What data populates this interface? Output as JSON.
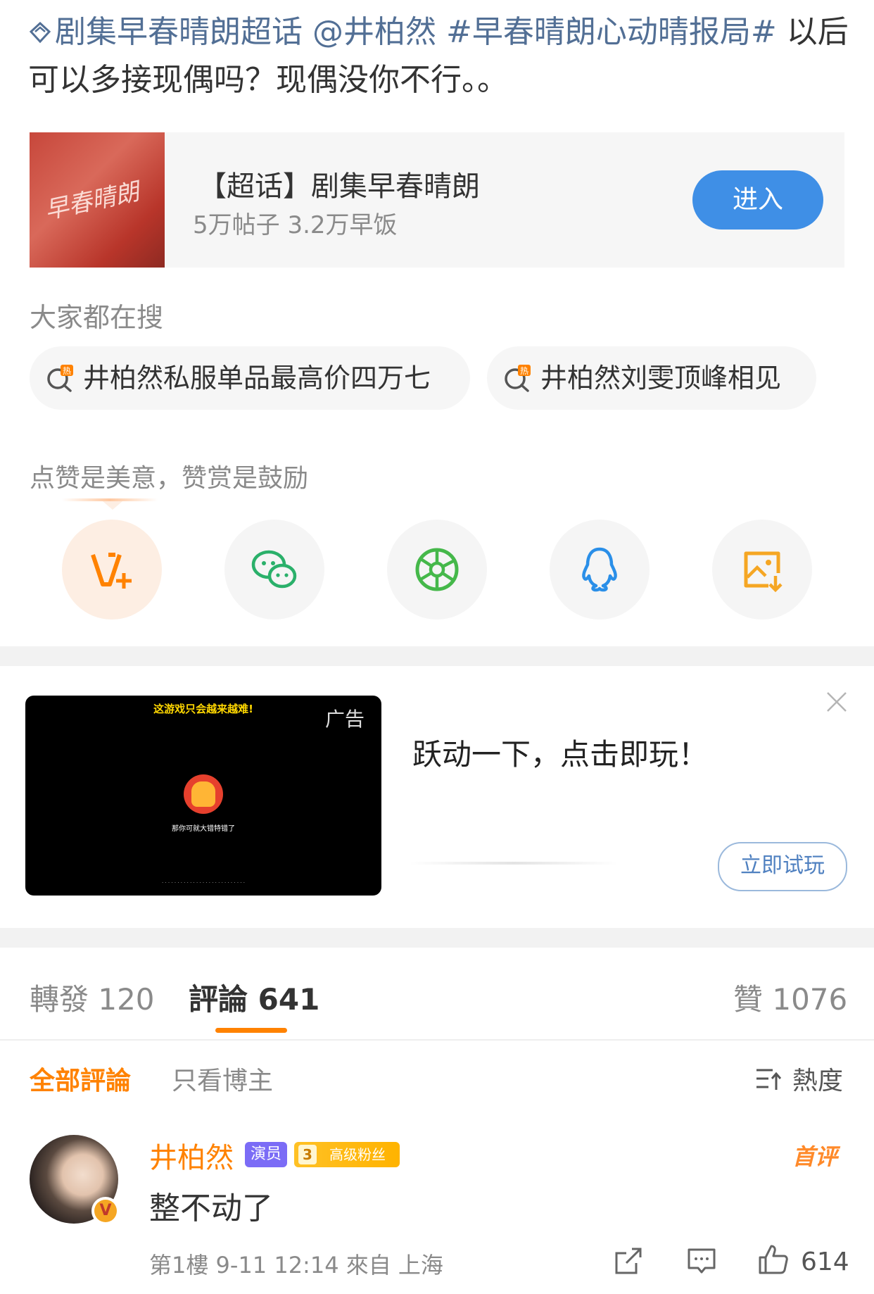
{
  "post": {
    "topic": "剧集早春晴朗超话",
    "mention": "@井柏然",
    "hashtag": "#早春晴朗心动晴报局#",
    "text": "以后可以多接现偶吗？现偶没你不行。。"
  },
  "supertopic_card": {
    "thumb_text": "早春晴朗",
    "title": "【超话】剧集早春晴朗",
    "stats": "5万帖子 3.2万早饭",
    "enter_label": "进入"
  },
  "hot_search": {
    "label": "大家都在搜",
    "items": [
      "井柏然私服单品最高价四万七",
      "井柏然刘雯顶峰相见"
    ]
  },
  "reward": {
    "label": "点赞是美意，赞赏是鼓励",
    "share_icons": [
      "v-plus-icon",
      "wechat-icon",
      "moments-icon",
      "qq-icon",
      "save-image-icon"
    ]
  },
  "ad": {
    "video_title": "这游戏只会越来越难!",
    "tag": "广告",
    "video_subtitle": "那你可就大错特错了",
    "headline": "跃动一下，点击即玩！",
    "cta": "立即试玩"
  },
  "stats": {
    "reposts": "轉發 120",
    "comments": "評論 641",
    "likes": "贊 1076"
  },
  "filter": {
    "all": "全部評論",
    "author_only": "只看博主",
    "sort": "熱度"
  },
  "comment": {
    "avatar_badge": "V",
    "name": "井柏然",
    "role_tag": "演员",
    "fan_level": "3",
    "fan_label": "高级粉丝",
    "first_badge": "首评",
    "text": "整不动了",
    "meta": "第1樓 9-11 12:14 來自 上海",
    "likes": "614"
  },
  "colors": {
    "accent": "#ff8200",
    "link": "#526f95",
    "button_blue": "#3f8fe6"
  }
}
